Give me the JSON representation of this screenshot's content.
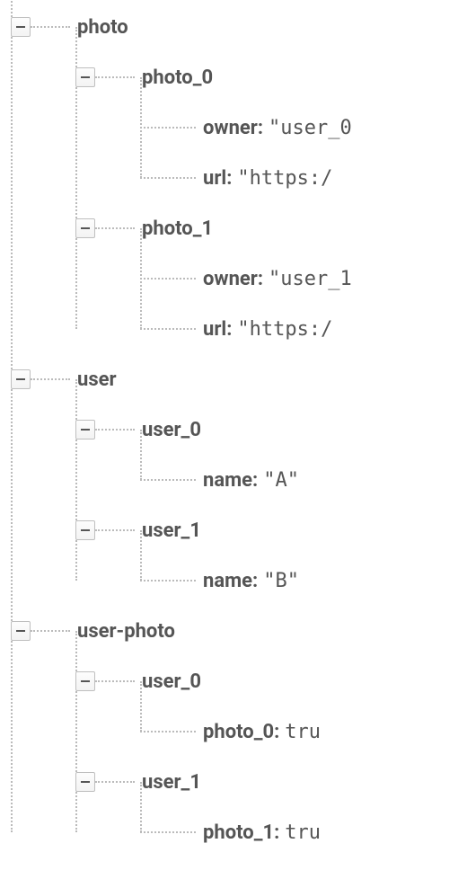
{
  "tree": {
    "photo": {
      "label": "photo",
      "children": {
        "photo_0": {
          "label": "photo_0",
          "fields": {
            "owner": {
              "key": "owner:",
              "val": "\"user_0"
            },
            "url": {
              "key": "url:",
              "val": "\"https:/"
            }
          }
        },
        "photo_1": {
          "label": "photo_1",
          "fields": {
            "owner": {
              "key": "owner:",
              "val": "\"user_1"
            },
            "url": {
              "key": "url:",
              "val": "\"https:/"
            }
          }
        }
      }
    },
    "user": {
      "label": "user",
      "children": {
        "user_0": {
          "label": "user_0",
          "fields": {
            "name": {
              "key": "name:",
              "val": "\"A\""
            }
          }
        },
        "user_1": {
          "label": "user_1",
          "fields": {
            "name": {
              "key": "name:",
              "val": "\"B\""
            }
          }
        }
      }
    },
    "user_photo": {
      "label": "user-photo",
      "children": {
        "user_0": {
          "label": "user_0",
          "fields": {
            "photo_0": {
              "key": "photo_0:",
              "val": "tru"
            }
          }
        },
        "user_1": {
          "label": "user_1",
          "fields": {
            "photo_1": {
              "key": "photo_1:",
              "val": "tru"
            }
          }
        }
      }
    }
  }
}
